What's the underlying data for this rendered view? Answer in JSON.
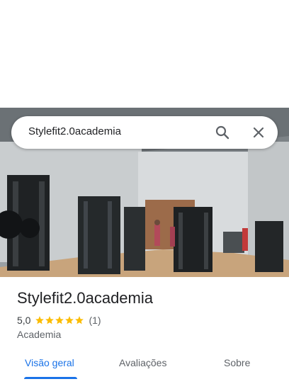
{
  "search": {
    "query": "Stylefit2.0academia",
    "search_icon": "search-icon",
    "close_icon": "close-icon"
  },
  "place": {
    "name": "Stylefit2.0academia",
    "rating": "5,0",
    "stars": 5,
    "review_count": "(1)",
    "category": "Academia",
    "star_color": "#fbbc04"
  },
  "tabs": [
    {
      "label": "Visão geral",
      "active": true
    },
    {
      "label": "Avaliações",
      "active": false
    },
    {
      "label": "Sobre",
      "active": false
    }
  ],
  "colors": {
    "accent": "#1a73e8",
    "text_primary": "#202124",
    "text_secondary": "#5f6368"
  }
}
